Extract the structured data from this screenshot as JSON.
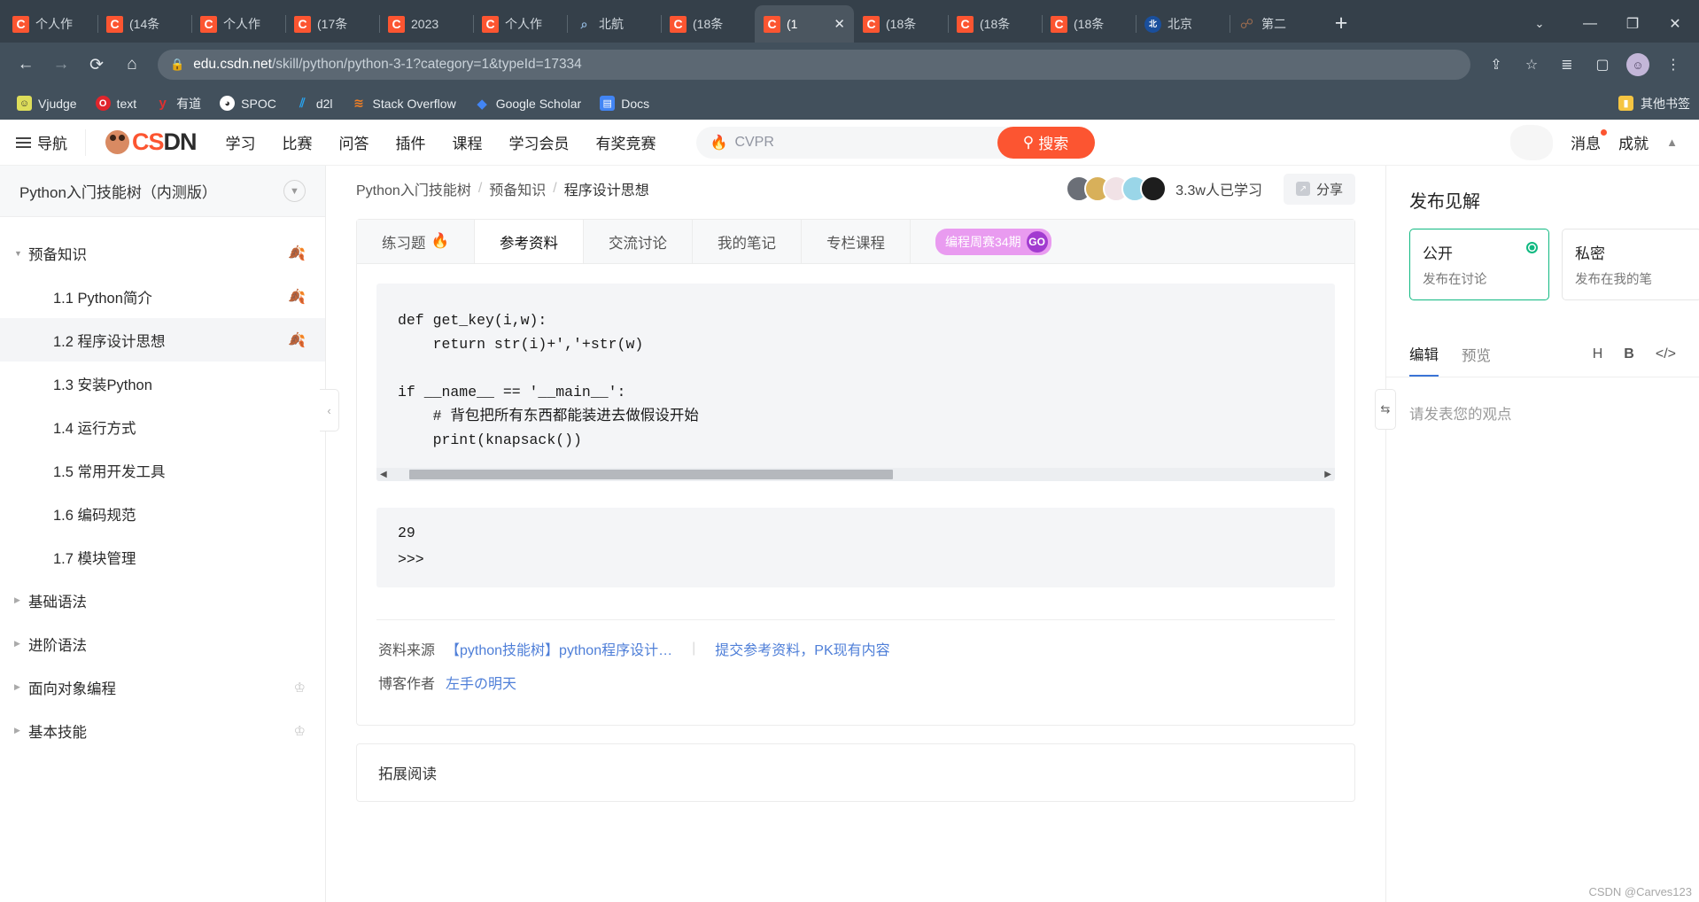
{
  "browser": {
    "tabs": [
      {
        "label": "个人作",
        "icon": "csdn-favicon",
        "active": false
      },
      {
        "label": "(14条",
        "icon": "csdn-favicon",
        "active": false
      },
      {
        "label": "个人作",
        "icon": "csdn-favicon",
        "active": false
      },
      {
        "label": "(17条",
        "icon": "csdn-favicon",
        "active": false
      },
      {
        "label": "2023",
        "icon": "csdn-favicon",
        "active": false
      },
      {
        "label": "个人作",
        "icon": "csdn-favicon",
        "active": false
      },
      {
        "label": "北航",
        "icon": "search-favicon",
        "active": false
      },
      {
        "label": "(18条",
        "icon": "csdn-favicon",
        "active": false
      },
      {
        "label": "(1",
        "icon": "csdn-favicon",
        "active": true
      },
      {
        "label": "(18条",
        "icon": "csdn-favicon",
        "active": false
      },
      {
        "label": "(18条",
        "icon": "csdn-favicon",
        "active": false
      },
      {
        "label": "(18条",
        "icon": "csdn-favicon",
        "active": false
      },
      {
        "label": "北京",
        "icon": "beihang-favicon",
        "active": false
      },
      {
        "label": "第二",
        "icon": "generic-favicon",
        "active": false
      }
    ],
    "new_tab_label": "+",
    "tab_close_label": "✕",
    "window_controls": {
      "list": "⌄",
      "minimize": "—",
      "maximize": "❐",
      "close": "✕"
    },
    "toolbar": {
      "back": "←",
      "forward": "→",
      "reload": "⟳",
      "home": "⌂",
      "lock": "🔒",
      "url_host": "edu.csdn.net",
      "url_path": "/skill/python/python-3-1?category=1&typeId=17334",
      "share": "⇪",
      "star": "☆",
      "reading_list": "≣",
      "side_panel": "▢",
      "profile": "◕",
      "menu": "⋮"
    },
    "bookmarks": [
      {
        "label": "Vjudge",
        "icon": "vjudge-icon",
        "color": "#d9d96a"
      },
      {
        "label": "text",
        "icon": "opera-icon",
        "color": "#e0252c"
      },
      {
        "label": "有道",
        "icon": "youdao-icon",
        "color": "#e03030"
      },
      {
        "label": "SPOC",
        "icon": "spoc-icon",
        "color": "#ffffff"
      },
      {
        "label": "d2l",
        "icon": "d2l-icon",
        "color": "#2196f3"
      },
      {
        "label": "Stack Overflow",
        "icon": "stackoverflow-icon",
        "color": "#f48024"
      },
      {
        "label": "Google Scholar",
        "icon": "scholar-icon",
        "color": "#4285f4"
      },
      {
        "label": "Docs",
        "icon": "docs-icon",
        "color": "#4285f4"
      }
    ],
    "other_bookmarks": {
      "label": "其他书签",
      "icon": "folder-icon"
    }
  },
  "csdn_nav": {
    "hamburger_label": "导航",
    "logo_text_dark": "CS",
    "logo_text_accent": "DN",
    "links": [
      "学习",
      "比赛",
      "问答",
      "插件",
      "课程",
      "学习会员",
      "有奖竞赛"
    ],
    "search": {
      "placeholder": "CVPR",
      "hot_icon": "flame-icon",
      "button_label": "搜索",
      "button_icon": "search-icon"
    },
    "right_items": [
      "消息",
      "成就"
    ],
    "scroll_up_icon": "▲"
  },
  "sidebar": {
    "header_title": "Python入门技能树（内测版）",
    "collapse_icon": "chevron-down-icon",
    "handle_icon": "chevron-left-icon",
    "items": [
      {
        "label": "预备知识",
        "level": "group",
        "caret": "open",
        "badge": "leaf-pale",
        "active": false
      },
      {
        "label": "1.1 Python简介",
        "level": "child",
        "caret": "none",
        "badge": "leaf-done",
        "active": false
      },
      {
        "label": "1.2 程序设计思想",
        "level": "child",
        "caret": "none",
        "badge": "leaf-pale",
        "active": true
      },
      {
        "label": "1.3 安装Python",
        "level": "child",
        "caret": "none",
        "badge": "none",
        "active": false
      },
      {
        "label": "1.4 运行方式",
        "level": "child",
        "caret": "none",
        "badge": "none",
        "active": false
      },
      {
        "label": "1.5 常用开发工具",
        "level": "child",
        "caret": "none",
        "badge": "none",
        "active": false
      },
      {
        "label": "1.6 编码规范",
        "level": "child",
        "caret": "none",
        "badge": "none",
        "active": false
      },
      {
        "label": "1.7 模块管理",
        "level": "child",
        "caret": "none",
        "badge": "none",
        "active": false
      },
      {
        "label": "基础语法",
        "level": "group",
        "caret": "closed",
        "badge": "none",
        "active": false
      },
      {
        "label": "进阶语法",
        "level": "group",
        "caret": "closed",
        "badge": "none",
        "active": false
      },
      {
        "label": "面向对象编程",
        "level": "group",
        "caret": "closed",
        "badge": "crown",
        "active": false
      },
      {
        "label": "基本技能",
        "level": "group",
        "caret": "closed",
        "badge": "crown",
        "active": false
      }
    ]
  },
  "main": {
    "breadcrumb": [
      "Python入门技能树",
      "预备知识",
      "程序设计思想"
    ],
    "breadcrumb_sep": "/",
    "learners_text": "3.3w人已学习",
    "share_label": "分享",
    "share_icon": "share-icon",
    "tabs": [
      {
        "label": "练习题",
        "icon": "flame-icon",
        "selected": false
      },
      {
        "label": "参考资料",
        "icon": "",
        "selected": true
      },
      {
        "label": "交流讨论",
        "icon": "",
        "selected": false
      },
      {
        "label": "我的笔记",
        "icon": "",
        "selected": false
      },
      {
        "label": "专栏课程",
        "icon": "",
        "selected": false
      }
    ],
    "race_badge": {
      "label": "编程周赛34期",
      "go": "GO"
    },
    "code": "def get_key(i,w):\n    return str(i)+','+str(w)\n\nif __name__ == '__main__':\n    # 背包把所有东西都能装进去做假设开始\n    print(knapsack())",
    "scroll_left_arrow": "◀",
    "scroll_right_arrow": "▶",
    "output": "29\n>>>",
    "source": {
      "label": "资料来源",
      "link": "【python技能树】python程序设计…",
      "action": "提交参考资料，PK现有内容",
      "author_label": "博客作者",
      "author_name": "左手の明天"
    },
    "extra_section_title": "拓展阅读",
    "panel_handle_icon": "resize-handle-icon"
  },
  "right_panel": {
    "title": "发布见解",
    "choices": [
      {
        "title": "公开",
        "subtitle": "发布在讨论",
        "selected": true
      },
      {
        "title": "私密",
        "subtitle": "发布在我的笔",
        "selected": false
      }
    ],
    "edit_tabs": [
      {
        "label": "编辑",
        "on": true
      },
      {
        "label": "预览",
        "on": false
      }
    ],
    "format_icons": [
      {
        "label": "H",
        "name": "heading-icon"
      },
      {
        "label": "B",
        "name": "bold-icon"
      },
      {
        "label": "</>",
        "name": "code-icon"
      }
    ],
    "editor_placeholder": "请发表您的观点"
  },
  "watermark": "CSDN @Carves123"
}
